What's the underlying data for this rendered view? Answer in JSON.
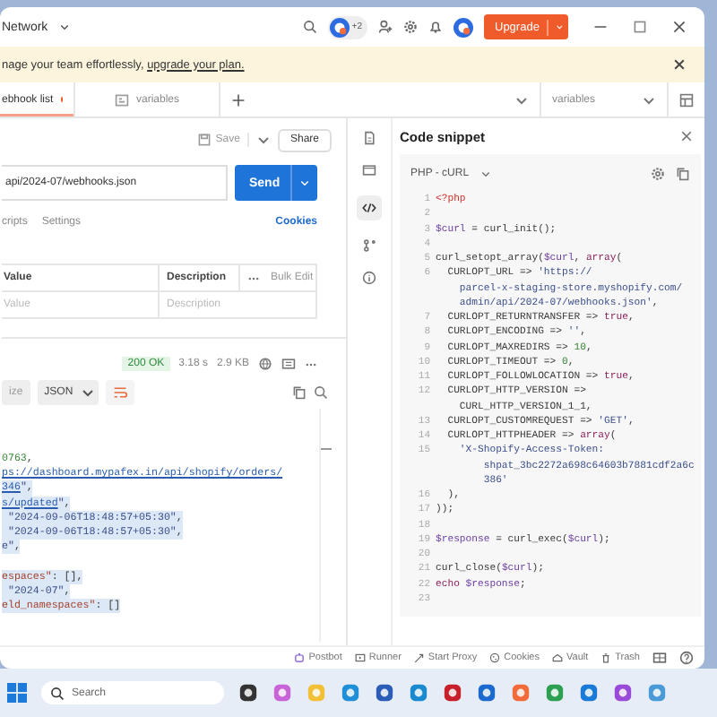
{
  "title_bar": {
    "workspace": "Network",
    "collaborators": "+2",
    "upgrade": "Upgrade"
  },
  "banner": {
    "text": "nage your team effortlessly, ",
    "link": "upgrade your plan."
  },
  "tabs": [
    {
      "label": "ebhook list",
      "unsaved": true,
      "selected": true
    },
    {
      "label": "variables",
      "unsaved": false,
      "selected": false
    }
  ],
  "environment": "variables",
  "request": {
    "save": "Save",
    "share": "Share",
    "url": "api/2024-07/webhooks.json",
    "send": "Send",
    "subtabs": [
      "cripts",
      "Settings"
    ],
    "cookies": "Cookies",
    "params_table": {
      "columns": [
        "Value",
        "Description"
      ],
      "bulk_edit": "Bulk Edit",
      "placeholders": [
        "Value",
        "Description"
      ]
    }
  },
  "response": {
    "status": "200 OK",
    "time": "3.18 s",
    "size": "2.9 KB",
    "view": "ize",
    "format": "JSON",
    "lines": [
      {
        "highlighted": false,
        "tokens": [
          {
            "kind": "num",
            "text": "0763"
          },
          {
            "kind": "plain",
            "text": ","
          }
        ]
      },
      {
        "highlighted": false,
        "tokens": [
          {
            "kind": "link",
            "text": "ps://dashboard.mypafex.in/api/shopify/orders/"
          }
        ]
      },
      {
        "highlighted": true,
        "tokens": [
          {
            "kind": "link",
            "text": "346"
          },
          {
            "kind": "str",
            "text": "\""
          },
          {
            "kind": "plain",
            "text": ","
          }
        ]
      },
      {
        "highlighted": true,
        "tokens": [
          {
            "kind": "link",
            "text": "s/updated"
          },
          {
            "kind": "str",
            "text": "\""
          },
          {
            "kind": "plain",
            "text": ","
          }
        ]
      },
      {
        "highlighted": true,
        "tokens": [
          {
            "kind": "str",
            "text": " \"2024-09-06T18:48:57+05:30\""
          },
          {
            "kind": "plain",
            "text": ","
          }
        ]
      },
      {
        "highlighted": true,
        "tokens": [
          {
            "kind": "str",
            "text": " \"2024-09-06T18:48:57+05:30\""
          },
          {
            "kind": "plain",
            "text": ","
          }
        ]
      },
      {
        "highlighted": true,
        "tokens": [
          {
            "kind": "str",
            "text": "e\""
          },
          {
            "kind": "plain",
            "text": ","
          }
        ]
      },
      {
        "highlighted": true,
        "blank_before": true,
        "tokens": [
          {
            "kind": "key",
            "text": "espaces\""
          },
          {
            "kind": "plain",
            "text": ": [],"
          }
        ]
      },
      {
        "highlighted": true,
        "tokens": [
          {
            "kind": "str",
            "text": " \"2024-07\""
          },
          {
            "kind": "plain",
            "text": ","
          }
        ]
      },
      {
        "highlighted": true,
        "tokens": [
          {
            "kind": "key",
            "text": "eld_namespaces\""
          },
          {
            "kind": "plain",
            "text": ": []"
          }
        ]
      }
    ]
  },
  "snippet": {
    "title": "Code snippet",
    "language": "PHP - cURL",
    "lines": [
      {
        "num": "1",
        "tokens": [
          {
            "kind": "tag",
            "text": "<?php"
          }
        ]
      },
      {
        "num": "2"
      },
      {
        "num": "3",
        "tokens": [
          {
            "kind": "var",
            "text": "$curl"
          },
          {
            "kind": "plain",
            "text": " = curl_init();"
          }
        ]
      },
      {
        "num": "4"
      },
      {
        "num": "5",
        "tokens": [
          {
            "kind": "plain",
            "text": "curl_setopt_array("
          },
          {
            "kind": "var",
            "text": "$curl"
          },
          {
            "kind": "plain",
            "text": ", "
          },
          {
            "kind": "kw",
            "text": "array"
          },
          {
            "kind": "plain",
            "text": "("
          }
        ]
      },
      {
        "num": "6",
        "tokens": [
          {
            "kind": "plain",
            "text": "  CURLOPT_URL => "
          },
          {
            "kind": "str",
            "text": "'https://"
          }
        ]
      },
      {
        "tokens": [
          {
            "kind": "str",
            "text": "    parcel-x-staging-store.myshopify.com/"
          }
        ]
      },
      {
        "tokens": [
          {
            "kind": "str",
            "text": "    admin/api/2024-07/webhooks.json'"
          },
          {
            "kind": "plain",
            "text": ","
          }
        ]
      },
      {
        "num": "7",
        "tokens": [
          {
            "kind": "plain",
            "text": "  CURLOPT_RETURNTRANSFER => "
          },
          {
            "kind": "kw",
            "text": "true"
          },
          {
            "kind": "plain",
            "text": ","
          }
        ]
      },
      {
        "num": "8",
        "tokens": [
          {
            "kind": "plain",
            "text": "  CURLOPT_ENCODING => "
          },
          {
            "kind": "str",
            "text": "''"
          },
          {
            "kind": "plain",
            "text": ","
          }
        ]
      },
      {
        "num": "9",
        "tokens": [
          {
            "kind": "plain",
            "text": "  CURLOPT_MAXREDIRS => "
          },
          {
            "kind": "num",
            "text": "10"
          },
          {
            "kind": "plain",
            "text": ","
          }
        ]
      },
      {
        "num": "10",
        "tokens": [
          {
            "kind": "plain",
            "text": "  CURLOPT_TIMEOUT => "
          },
          {
            "kind": "num",
            "text": "0"
          },
          {
            "kind": "plain",
            "text": ","
          }
        ]
      },
      {
        "num": "11",
        "tokens": [
          {
            "kind": "plain",
            "text": "  CURLOPT_FOLLOWLOCATION => "
          },
          {
            "kind": "kw",
            "text": "true"
          },
          {
            "kind": "plain",
            "text": ","
          }
        ]
      },
      {
        "num": "12",
        "tokens": [
          {
            "kind": "plain",
            "text": "  CURLOPT_HTTP_VERSION =>"
          }
        ]
      },
      {
        "tokens": [
          {
            "kind": "plain",
            "text": "    CURL_HTTP_VERSION_1_1,"
          }
        ]
      },
      {
        "num": "13",
        "tokens": [
          {
            "kind": "plain",
            "text": "  CURLOPT_CUSTOMREQUEST => "
          },
          {
            "kind": "str",
            "text": "'GET'"
          },
          {
            "kind": "plain",
            "text": ","
          }
        ]
      },
      {
        "num": "14",
        "tokens": [
          {
            "kind": "plain",
            "text": "  CURLOPT_HTTPHEADER => "
          },
          {
            "kind": "kw",
            "text": "array"
          },
          {
            "kind": "plain",
            "text": "("
          }
        ]
      },
      {
        "num": "15",
        "tokens": [
          {
            "kind": "str",
            "text": "    'X-Shopify-Access-Token:"
          }
        ]
      },
      {
        "tokens": [
          {
            "kind": "str",
            "text": "        shpat_3bc2272a698c64603b7881cdf2a6c"
          }
        ]
      },
      {
        "tokens": [
          {
            "kind": "str",
            "text": "        386'"
          }
        ]
      },
      {
        "num": "16",
        "tokens": [
          {
            "kind": "plain",
            "text": "  ),"
          }
        ]
      },
      {
        "num": "17",
        "tokens": [
          {
            "kind": "plain",
            "text": "));"
          }
        ]
      },
      {
        "num": "18"
      },
      {
        "num": "19",
        "tokens": [
          {
            "kind": "var",
            "text": "$response"
          },
          {
            "kind": "plain",
            "text": " = curl_exec("
          },
          {
            "kind": "var",
            "text": "$curl"
          },
          {
            "kind": "plain",
            "text": ");"
          }
        ]
      },
      {
        "num": "20"
      },
      {
        "num": "21",
        "tokens": [
          {
            "kind": "plain",
            "text": "curl_close("
          },
          {
            "kind": "var",
            "text": "$curl"
          },
          {
            "kind": "plain",
            "text": ");"
          }
        ]
      },
      {
        "num": "22",
        "tokens": [
          {
            "kind": "kw",
            "text": "echo"
          },
          {
            "kind": "var",
            "text": " $response"
          },
          {
            "kind": "plain",
            "text": ";"
          }
        ]
      },
      {
        "num": "23"
      }
    ]
  },
  "status_bar": [
    {
      "kind": "bot",
      "label": "Postbot"
    },
    {
      "kind": "runner",
      "label": "Runner"
    },
    {
      "kind": "proxy",
      "label": "Start Proxy"
    },
    {
      "kind": "cookies",
      "label": "Cookies"
    },
    {
      "kind": "vault",
      "label": "Vault"
    },
    {
      "kind": "trash",
      "label": "Trash"
    }
  ],
  "taskbar": {
    "search_placeholder": "Search"
  }
}
